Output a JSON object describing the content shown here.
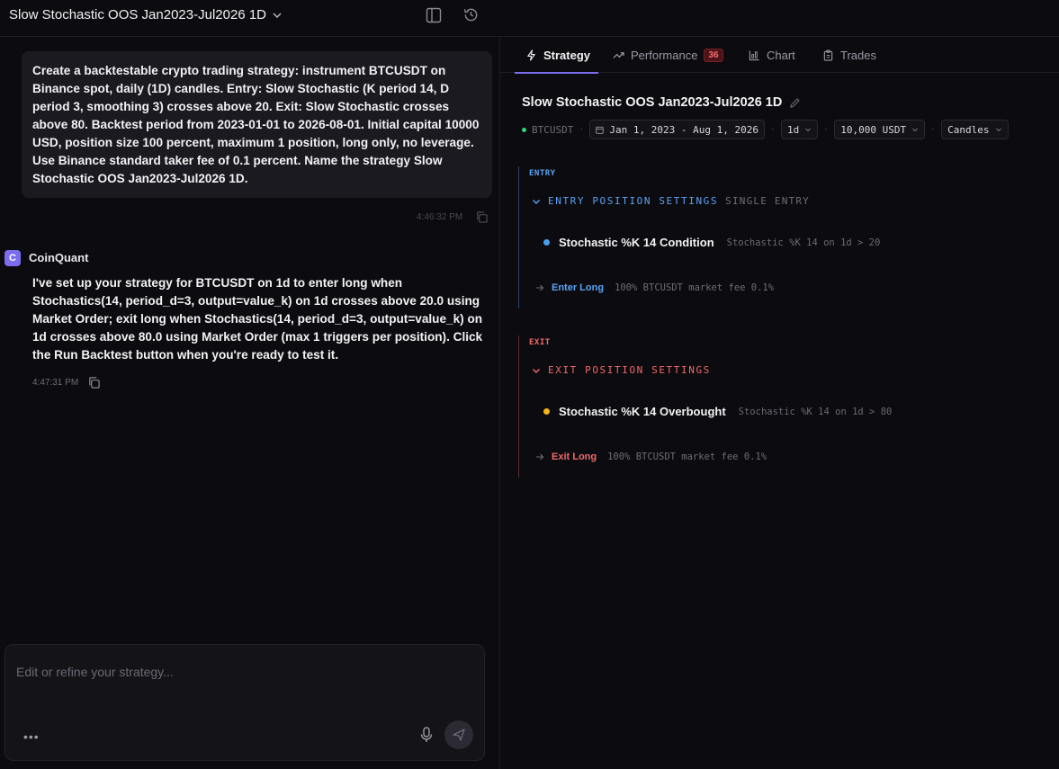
{
  "header": {
    "title": "Slow Stochastic OOS Jan2023-Jul2026 1D"
  },
  "chat": {
    "user_message": "Create a backtestable crypto trading strategy: instrument BTCUSDT on Binance spot, daily (1D) candles. Entry: Slow Stochastic (K period 14, D period 3, smoothing 3) crosses above 20. Exit: Slow Stochastic crosses above 80. Backtest period from 2023-01-01 to 2026-08-01. Initial capital 10000 USD, position size 100 percent, maximum 1 position, long only, no leverage. Use Binance standard taker fee of 0.1 percent. Name the strategy Slow Stochastic OOS Jan2023-Jul2026 1D.",
    "user_time": "4:46:32 PM",
    "bot_name": "CoinQuant",
    "bot_message": "I've set up your strategy for BTCUSDT on 1d to enter long when Stochastics(14, period_d=3, output=value_k) on 1d crosses above 20.0 using Market Order; exit long when Stochastics(14, period_d=3, output=value_k) on 1d crosses above 80.0 using Market Order (max 1 triggers per position). Click the Run Backtest button when you're ready to test it.",
    "bot_time": "4:47:31 PM"
  },
  "composer": {
    "placeholder": "Edit or refine your strategy...",
    "more_label": "•••"
  },
  "tabs": {
    "strategy": "Strategy",
    "performance": "Performance",
    "performance_badge": "36",
    "chart": "Chart",
    "trades": "Trades"
  },
  "strategy": {
    "title": "Slow Stochastic OOS Jan2023-Jul2026 1D",
    "symbol": "BTCUSDT",
    "date_range": "Jan 1, 2023 - Aug 1, 2026",
    "timeframe": "1d",
    "capital": "10,000 USDT",
    "chart_type": "Candles",
    "entry": {
      "label": "ENTRY",
      "settings_title": "ENTRY POSITION SETTINGS",
      "settings_sub": "SINGLE ENTRY",
      "condition_name": "Stochastic %K 14 Condition",
      "condition_desc": "Stochastic %K 14 on 1d > 20",
      "action_name": "Enter Long",
      "action_desc": "100% BTCUSDT market fee 0.1%"
    },
    "exit": {
      "label": "EXIT",
      "settings_title": "EXIT POSITION SETTINGS",
      "condition_name": "Stochastic %K 14 Overbought",
      "condition_desc": "Stochastic %K 14 on 1d > 80",
      "action_name": "Exit Long",
      "action_desc": "100% BTCUSDT market fee 0.1%"
    }
  },
  "colors": {
    "accent": "#7b6cf0",
    "entry": "#5aa3f5",
    "exit": "#f06a6a",
    "entry_bullet": "#4aa0f0",
    "exit_bullet": "#f5b418",
    "symbol_status": "#2fd57a"
  }
}
